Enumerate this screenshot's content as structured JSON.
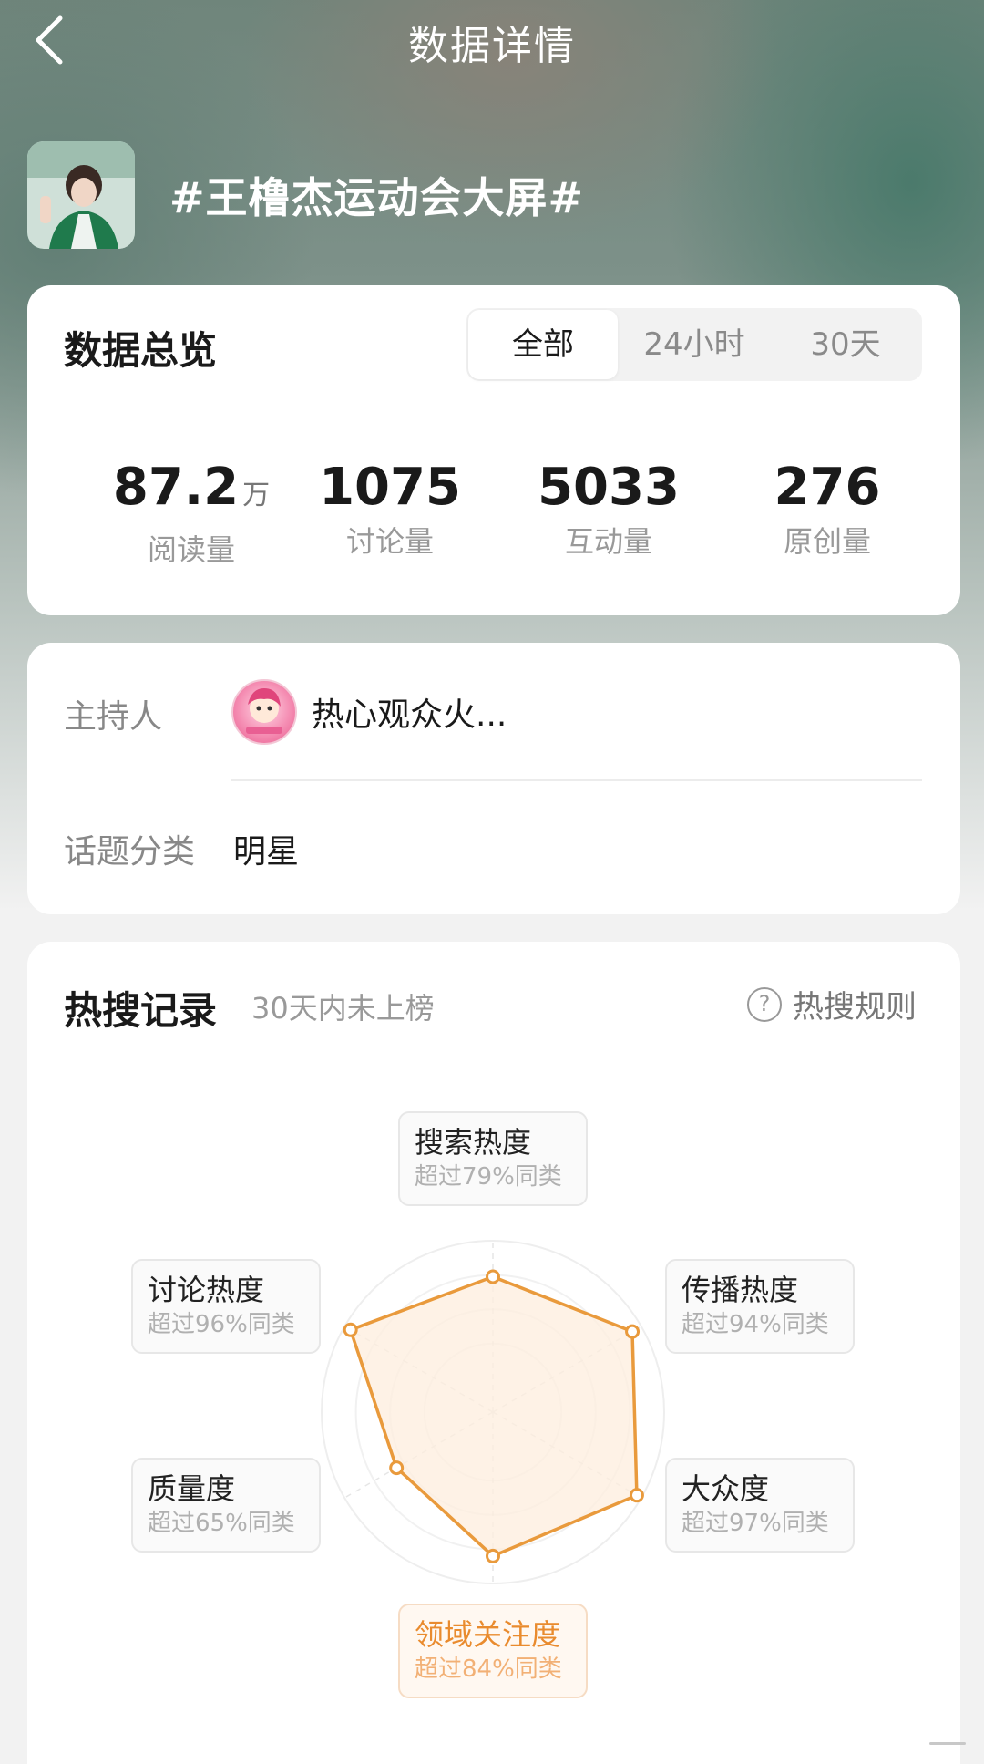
{
  "header": {
    "title": "数据详情"
  },
  "topic": {
    "title": "#王橹杰运动会大屏#"
  },
  "overview": {
    "title": "数据总览",
    "tabs": [
      {
        "label": "全部",
        "active": true
      },
      {
        "label": "24小时",
        "active": false
      },
      {
        "label": "30天",
        "active": false
      }
    ],
    "stats": [
      {
        "value": "87.2",
        "unit": "万",
        "label": "阅读量"
      },
      {
        "value": "1075",
        "unit": "",
        "label": "讨论量"
      },
      {
        "value": "5033",
        "unit": "",
        "label": "互动量"
      },
      {
        "value": "276",
        "unit": "",
        "label": "原创量"
      }
    ]
  },
  "host": {
    "host_label": "主持人",
    "host_name": "热心观众火...",
    "category_label": "话题分类",
    "category_value": "明星"
  },
  "hot_search": {
    "title": "热搜记录",
    "subtitle": "30天内未上榜",
    "rule_icon": "question-circle-icon",
    "rule_label": "热搜规则"
  },
  "radar": {
    "accent_color": "#e99a3c",
    "fill_color": "#fdeede",
    "highlighted": "领域关注度",
    "dimensions": [
      {
        "name": "搜索热度",
        "percentile_text": "超过79%同类",
        "value": 79
      },
      {
        "name": "传播热度",
        "percentile_text": "超过94%同类",
        "value": 94
      },
      {
        "name": "大众度",
        "percentile_text": "超过97%同类",
        "value": 97
      },
      {
        "name": "领域关注度",
        "percentile_text": "超过84%同类",
        "value": 84
      },
      {
        "name": "质量度",
        "percentile_text": "超过65%同类",
        "value": 65
      },
      {
        "name": "讨论热度",
        "percentile_text": "超过96%同类",
        "value": 96
      }
    ]
  }
}
